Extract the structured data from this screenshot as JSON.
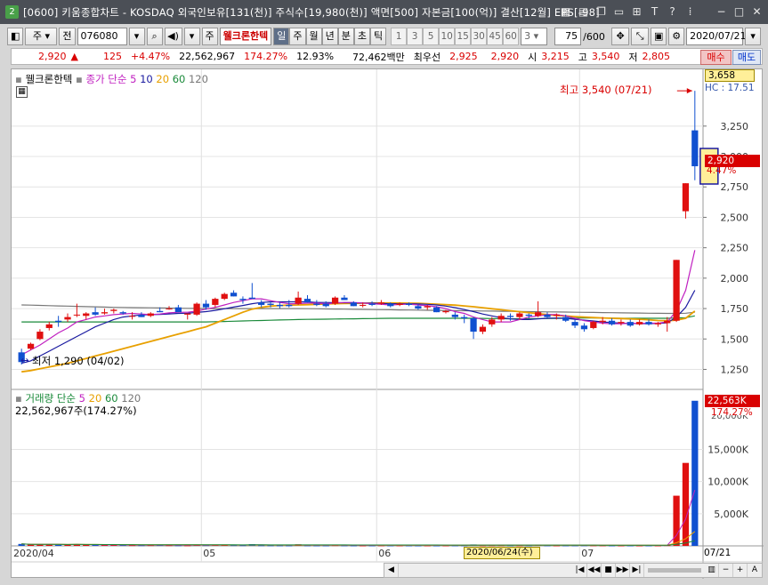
{
  "window": {
    "badge": "2",
    "title": "[0600] 키움종합차트 - KOSDAQ 외국인보유[131(천)] 주식수[19,980(천)] 액면[500] 자본금[100(억)] 결산[12월] EPS[-98]",
    "icons": [
      "grid-icon",
      "book-icon",
      "copy-icon",
      "restore-icon",
      "pin-icon",
      "text-icon",
      "help-icon",
      "minimize-icon",
      "maximize-icon",
      "close-icon"
    ]
  },
  "toolbar": {
    "type_label": "주",
    "jeon_label": "전",
    "code": "076080",
    "market_tag": "주",
    "stock_name": "웰크론한텍",
    "periods": [
      "일",
      "주",
      "월",
      "년",
      "분",
      "초",
      "틱"
    ],
    "active_period": "일",
    "intervals": [
      "1",
      "3",
      "5",
      "10",
      "15",
      "30",
      "45",
      "60"
    ],
    "interval_select": "3",
    "count": "75",
    "count_total": "/600",
    "date": "2020/07/21"
  },
  "quote": {
    "price": "2,920",
    "arrow": "▲",
    "change": "125",
    "change_pct": "+4.47%",
    "volume": "22,562,967",
    "volume_ratio": "174.27%",
    "turnover": "12.93%",
    "amount": "72,462백만",
    "bid_label": "최우선",
    "bid": "2,925",
    "ask": "2,920",
    "open_label": "시",
    "open": "3,215",
    "high_label": "고",
    "high": "3,540",
    "low_label": "저",
    "low": "2,805",
    "buy_label": "매수",
    "sell_label": "매도"
  },
  "price_pane": {
    "title": "웰크론한텍",
    "ma_label": "종가 단순",
    "ma_periods": [
      "5",
      "10",
      "20",
      "60",
      "120"
    ],
    "high_annotation": "최고 3,540 (07/21)",
    "low_annotation": "최저 1,290 (04/02)",
    "top_label": "3,658",
    "hc_label": "HC : 17.51",
    "current_price": "2,920",
    "current_pct": "4.47%"
  },
  "volume_pane": {
    "title": "거래량 단순",
    "ma_periods": [
      "5",
      "20",
      "60",
      "120"
    ],
    "info": "22,562,967주(174.27%)",
    "current_volume": "22,563K",
    "current_pct": "174.27%",
    "axis_top_label": "20,000K"
  },
  "x_axis": {
    "labels": [
      {
        "text": "2020/04",
        "i": 0
      },
      {
        "text": "05",
        "i": 20
      },
      {
        "text": "06",
        "i": 39
      },
      {
        "text": "07",
        "i": 61
      }
    ],
    "cursor_label": "2020/06/24(수)",
    "end_label": "07/21"
  },
  "chart_data": {
    "type": "candlestick",
    "dates_range": [
      "2020/04/01",
      "2020/07/21"
    ],
    "price_ticks": [
      3250,
      3000,
      2750,
      2500,
      2250,
      2000,
      1750,
      1500,
      1250
    ],
    "ylim": [
      1100,
      3658
    ],
    "volume_ticks": [
      "15,000K",
      "10,000K",
      "5,000K"
    ],
    "volume_tick_values": [
      15000,
      10000,
      5000
    ],
    "volume_ylim": [
      0,
      23500
    ],
    "candles": [
      {
        "o": 1390,
        "h": 1420,
        "l": 1290,
        "c": 1310
      },
      {
        "o": 1420,
        "h": 1470,
        "l": 1410,
        "c": 1460
      },
      {
        "o": 1500,
        "h": 1580,
        "l": 1490,
        "c": 1560
      },
      {
        "o": 1590,
        "h": 1640,
        "l": 1570,
        "c": 1620
      },
      {
        "o": 1650,
        "h": 1690,
        "l": 1600,
        "c": 1640
      },
      {
        "o": 1660,
        "h": 1710,
        "l": 1640,
        "c": 1680
      },
      {
        "o": 1700,
        "h": 1790,
        "l": 1680,
        "c": 1700
      },
      {
        "o": 1690,
        "h": 1720,
        "l": 1660,
        "c": 1710
      },
      {
        "o": 1720,
        "h": 1760,
        "l": 1690,
        "c": 1700
      },
      {
        "o": 1710,
        "h": 1750,
        "l": 1700,
        "c": 1720
      },
      {
        "o": 1730,
        "h": 1750,
        "l": 1710,
        "c": 1740
      },
      {
        "o": 1720,
        "h": 1730,
        "l": 1700,
        "c": 1710
      },
      {
        "o": 1690,
        "h": 1720,
        "l": 1660,
        "c": 1690
      },
      {
        "o": 1700,
        "h": 1720,
        "l": 1680,
        "c": 1680
      },
      {
        "o": 1690,
        "h": 1720,
        "l": 1680,
        "c": 1710
      },
      {
        "o": 1730,
        "h": 1760,
        "l": 1720,
        "c": 1720
      },
      {
        "o": 1750,
        "h": 1770,
        "l": 1740,
        "c": 1750
      },
      {
        "o": 1760,
        "h": 1780,
        "l": 1720,
        "c": 1720
      },
      {
        "o": 1700,
        "h": 1710,
        "l": 1660,
        "c": 1710
      },
      {
        "o": 1700,
        "h": 1800,
        "l": 1690,
        "c": 1790
      },
      {
        "o": 1790,
        "h": 1820,
        "l": 1740,
        "c": 1760
      },
      {
        "o": 1780,
        "h": 1840,
        "l": 1760,
        "c": 1830
      },
      {
        "o": 1830,
        "h": 1880,
        "l": 1820,
        "c": 1870
      },
      {
        "o": 1880,
        "h": 1900,
        "l": 1850,
        "c": 1850
      },
      {
        "o": 1830,
        "h": 1850,
        "l": 1790,
        "c": 1820
      },
      {
        "o": 1840,
        "h": 1960,
        "l": 1830,
        "c": 1830
      },
      {
        "o": 1800,
        "h": 1820,
        "l": 1760,
        "c": 1780
      },
      {
        "o": 1790,
        "h": 1810,
        "l": 1760,
        "c": 1780
      },
      {
        "o": 1780,
        "h": 1800,
        "l": 1750,
        "c": 1770
      },
      {
        "o": 1780,
        "h": 1820,
        "l": 1760,
        "c": 1770
      },
      {
        "o": 1790,
        "h": 1890,
        "l": 1780,
        "c": 1840
      },
      {
        "o": 1830,
        "h": 1860,
        "l": 1800,
        "c": 1800
      },
      {
        "o": 1790,
        "h": 1820,
        "l": 1770,
        "c": 1780
      },
      {
        "o": 1790,
        "h": 1810,
        "l": 1760,
        "c": 1770
      },
      {
        "o": 1790,
        "h": 1850,
        "l": 1780,
        "c": 1840
      },
      {
        "o": 1840,
        "h": 1860,
        "l": 1820,
        "c": 1820
      },
      {
        "o": 1800,
        "h": 1810,
        "l": 1770,
        "c": 1770
      },
      {
        "o": 1780,
        "h": 1800,
        "l": 1760,
        "c": 1780
      },
      {
        "o": 1790,
        "h": 1810,
        "l": 1770,
        "c": 1780
      },
      {
        "o": 1790,
        "h": 1820,
        "l": 1780,
        "c": 1800
      },
      {
        "o": 1790,
        "h": 1800,
        "l": 1760,
        "c": 1770
      },
      {
        "o": 1780,
        "h": 1800,
        "l": 1770,
        "c": 1790
      },
      {
        "o": 1790,
        "h": 1800,
        "l": 1770,
        "c": 1780
      },
      {
        "o": 1770,
        "h": 1790,
        "l": 1740,
        "c": 1750
      },
      {
        "o": 1760,
        "h": 1780,
        "l": 1740,
        "c": 1770
      },
      {
        "o": 1760,
        "h": 1770,
        "l": 1720,
        "c": 1720
      },
      {
        "o": 1720,
        "h": 1740,
        "l": 1710,
        "c": 1730
      },
      {
        "o": 1700,
        "h": 1720,
        "l": 1660,
        "c": 1680
      },
      {
        "o": 1680,
        "h": 1700,
        "l": 1630,
        "c": 1670
      },
      {
        "o": 1670,
        "h": 1680,
        "l": 1500,
        "c": 1560
      },
      {
        "o": 1560,
        "h": 1620,
        "l": 1540,
        "c": 1600
      },
      {
        "o": 1620,
        "h": 1680,
        "l": 1600,
        "c": 1660
      },
      {
        "o": 1660,
        "h": 1710,
        "l": 1640,
        "c": 1690
      },
      {
        "o": 1690,
        "h": 1710,
        "l": 1650,
        "c": 1680
      },
      {
        "o": 1680,
        "h": 1720,
        "l": 1660,
        "c": 1710
      },
      {
        "o": 1700,
        "h": 1710,
        "l": 1670,
        "c": 1690
      },
      {
        "o": 1690,
        "h": 1810,
        "l": 1680,
        "c": 1720
      },
      {
        "o": 1700,
        "h": 1720,
        "l": 1670,
        "c": 1680
      },
      {
        "o": 1690,
        "h": 1710,
        "l": 1660,
        "c": 1700
      },
      {
        "o": 1680,
        "h": 1700,
        "l": 1640,
        "c": 1650
      },
      {
        "o": 1640,
        "h": 1660,
        "l": 1590,
        "c": 1610
      },
      {
        "o": 1610,
        "h": 1630,
        "l": 1560,
        "c": 1580
      },
      {
        "o": 1590,
        "h": 1650,
        "l": 1580,
        "c": 1640
      },
      {
        "o": 1640,
        "h": 1680,
        "l": 1620,
        "c": 1650
      },
      {
        "o": 1650,
        "h": 1670,
        "l": 1610,
        "c": 1620
      },
      {
        "o": 1630,
        "h": 1660,
        "l": 1610,
        "c": 1640
      },
      {
        "o": 1640,
        "h": 1660,
        "l": 1600,
        "c": 1610
      },
      {
        "o": 1620,
        "h": 1660,
        "l": 1610,
        "c": 1640
      },
      {
        "o": 1640,
        "h": 1660,
        "l": 1610,
        "c": 1620
      },
      {
        "o": 1620,
        "h": 1640,
        "l": 1600,
        "c": 1630
      },
      {
        "o": 1630,
        "h": 1680,
        "l": 1560,
        "c": 1650
      },
      {
        "o": 1650,
        "h": 2150,
        "l": 1640,
        "c": 2150
      },
      {
        "o": 2550,
        "h": 2780,
        "l": 2490,
        "c": 2780
      },
      {
        "o": 3215,
        "h": 3540,
        "l": 2805,
        "c": 2920
      }
    ],
    "ma5": [
      1370,
      1410,
      1450,
      1500,
      1550,
      1590,
      1640,
      1660,
      1680,
      1690,
      1700,
      1705,
      1710,
      1705,
      1700,
      1705,
      1715,
      1720,
      1720,
      1730,
      1745,
      1760,
      1780,
      1800,
      1815,
      1830,
      1830,
      1815,
      1800,
      1790,
      1790,
      1795,
      1795,
      1790,
      1795,
      1800,
      1800,
      1795,
      1790,
      1785,
      1780,
      1783,
      1786,
      1780,
      1773,
      1765,
      1750,
      1725,
      1710,
      1680,
      1660,
      1640,
      1640,
      1640,
      1660,
      1680,
      1690,
      1700,
      1700,
      1690,
      1670,
      1650,
      1640,
      1630,
      1625,
      1625,
      1630,
      1628,
      1630,
      1630,
      1640,
      1730,
      1900,
      2230
    ],
    "ma10": [
      1300,
      1320,
      1360,
      1400,
      1440,
      1480,
      1520,
      1560,
      1600,
      1630,
      1660,
      1680,
      1690,
      1698,
      1700,
      1702,
      1706,
      1710,
      1712,
      1718,
      1725,
      1735,
      1748,
      1762,
      1775,
      1790,
      1800,
      1805,
      1805,
      1805,
      1805,
      1805,
      1800,
      1800,
      1798,
      1798,
      1797,
      1795,
      1794,
      1792,
      1790,
      1789,
      1789,
      1788,
      1785,
      1780,
      1770,
      1758,
      1742,
      1725,
      1705,
      1690,
      1675,
      1665,
      1660,
      1660,
      1665,
      1670,
      1672,
      1670,
      1662,
      1655,
      1648,
      1640,
      1635,
      1630,
      1628,
      1626,
      1626,
      1628,
      1632,
      1680,
      1760,
      1900
    ],
    "ma20": [
      1230,
      1240,
      1255,
      1270,
      1285,
      1300,
      1320,
      1340,
      1360,
      1380,
      1400,
      1420,
      1440,
      1460,
      1480,
      1500,
      1520,
      1540,
      1560,
      1580,
      1600,
      1630,
      1660,
      1690,
      1720,
      1745,
      1760,
      1770,
      1775,
      1778,
      1780,
      1782,
      1785,
      1788,
      1790,
      1792,
      1793,
      1794,
      1795,
      1796,
      1796,
      1795,
      1794,
      1793,
      1790,
      1786,
      1782,
      1778,
      1772,
      1765,
      1757,
      1748,
      1740,
      1732,
      1724,
      1716,
      1708,
      1700,
      1694,
      1689,
      1684,
      1680,
      1676,
      1673,
      1670,
      1668,
      1665,
      1662,
      1658,
      1652,
      1650,
      1655,
      1670,
      1730
    ],
    "ma60": [
      1640,
      1640,
      1640,
      1640,
      1640,
      1640,
      1640,
      1640,
      1640,
      1640,
      1640,
      1640,
      1640,
      1640,
      1640,
      1640,
      1640,
      1640,
      1640,
      1640,
      1640,
      1642,
      1644,
      1646,
      1648,
      1650,
      1652,
      1654,
      1656,
      1658,
      1660,
      1661,
      1662,
      1663,
      1664,
      1665,
      1666,
      1667,
      1668,
      1669,
      1670,
      1670,
      1670,
      1670,
      1670,
      1670,
      1670,
      1670,
      1670,
      1670,
      1669,
      1668,
      1667,
      1666,
      1666,
      1666,
      1667,
      1668,
      1669,
      1670,
      1671,
      1672,
      1672,
      1672,
      1671,
      1670,
      1670,
      1670,
      1670,
      1670,
      1670,
      1672,
      1675,
      1690
    ],
    "ma120": [
      1780,
      1778,
      1776,
      1774,
      1772,
      1770,
      1768,
      1766,
      1764,
      1762,
      1760,
      1759,
      1758,
      1757,
      1756,
      1755,
      1754,
      1753,
      1752,
      1751,
      1750,
      1750,
      1750,
      1750,
      1750,
      1750,
      1750,
      1750,
      1750,
      1750,
      1750,
      1749,
      1748,
      1747,
      1746,
      1745,
      1744,
      1743,
      1742,
      1741,
      1740,
      1739,
      1738,
      1737,
      1736,
      1735,
      1734,
      1733,
      1732,
      1731,
      1730,
      1729,
      1728,
      1727,
      1726,
      1725,
      1724,
      1723,
      1722,
      1721,
      1720,
      1719,
      1718,
      1717,
      1716,
      1715,
      1714,
      1713,
      1712,
      1711,
      1710,
      1710,
      1712,
      1720
    ],
    "volumes": [
      300,
      200,
      250,
      220,
      180,
      200,
      260,
      180,
      150,
      140,
      150,
      130,
      120,
      110,
      120,
      130,
      110,
      100,
      90,
      160,
      120,
      140,
      150,
      120,
      110,
      260,
      100,
      90,
      85,
      80,
      240,
      90,
      80,
      80,
      120,
      90,
      80,
      75,
      80,
      90,
      80,
      85,
      80,
      75,
      80,
      70,
      80,
      85,
      90,
      220,
      90,
      100,
      110,
      95,
      90,
      85,
      170,
      90,
      80,
      85,
      90,
      100,
      95,
      90,
      80,
      75,
      80,
      70,
      80,
      75,
      120,
      7800,
      12900,
      22563
    ]
  }
}
